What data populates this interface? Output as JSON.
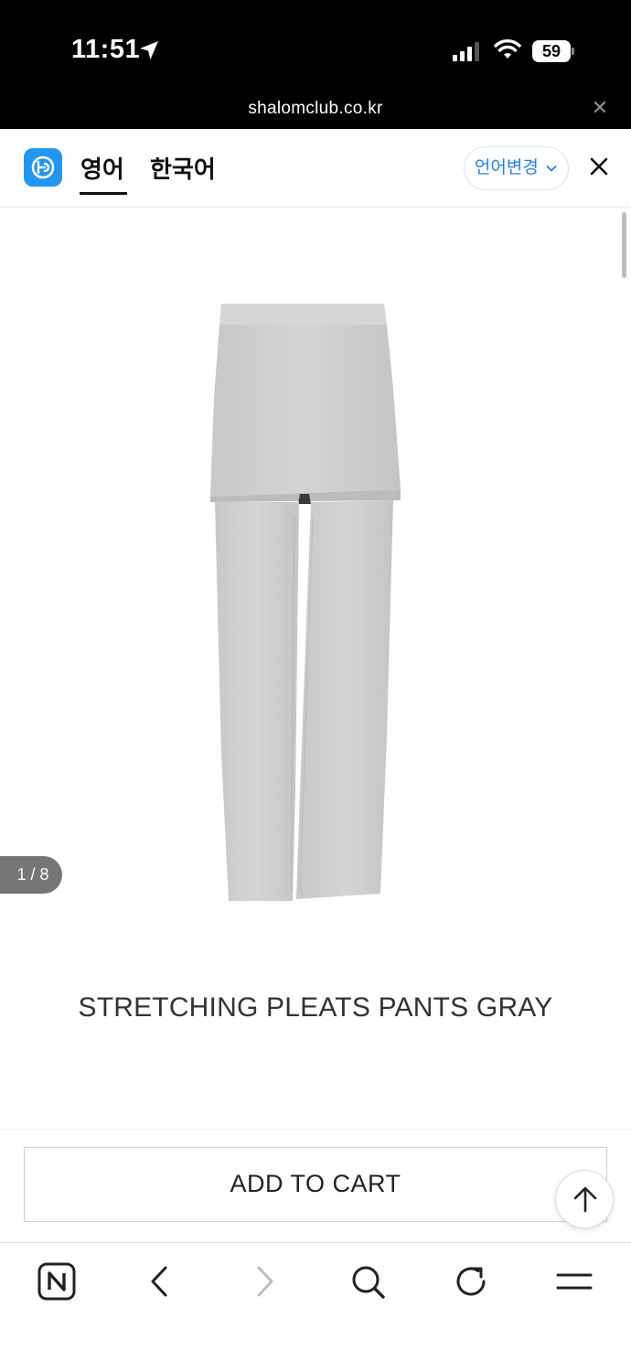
{
  "status_bar": {
    "time": "11:51",
    "battery_level": "59",
    "icons": [
      "location-arrow-icon",
      "cellular-signal-icon",
      "wifi-icon",
      "battery-icon"
    ]
  },
  "browser": {
    "url": "shalomclub.co.kr",
    "close_icon": "close-icon"
  },
  "translate_bar": {
    "tab_english": "영어",
    "tab_korean": "한국어",
    "active_tab": "영어",
    "change_language": "언어변경",
    "close_label": "✕",
    "accent_color": "#2680e6"
  },
  "product": {
    "image_counter": "1 / 8",
    "title": "STRETCHING PLEATS PANTS GRAY",
    "image_color": "#cfcdcf"
  },
  "cart": {
    "add_to_cart": "ADD TO CART"
  },
  "bottom_nav": {
    "items": [
      "naver-home-icon",
      "back-icon",
      "forward-icon",
      "search-icon",
      "reload-icon",
      "menu-icon"
    ]
  }
}
